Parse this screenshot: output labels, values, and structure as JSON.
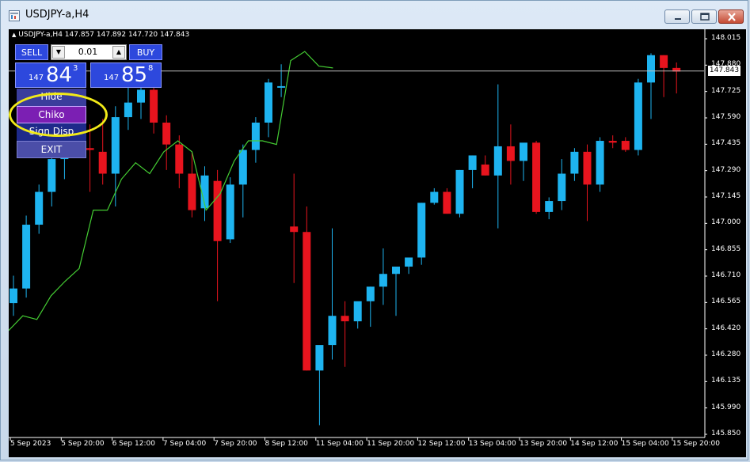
{
  "window": {
    "title": "USDJPY-a,H4"
  },
  "chart_header": {
    "symbol_line": "USDJPY-a,H4  147.857 147.892 147.720 147.843"
  },
  "trade_panel": {
    "sell_label": "SELL",
    "buy_label": "BUY",
    "lot_value": "0.01",
    "sell_price": {
      "prefix": "147",
      "big": "84",
      "sup": "3"
    },
    "buy_price": {
      "prefix": "147",
      "big": "85",
      "sup": "8"
    },
    "menu": [
      {
        "label": "Hide",
        "color": "#3a3d9c"
      },
      {
        "label": "Chiko",
        "color": "#7b1fb3"
      },
      {
        "label": "Sign Disp",
        "color": "#1e2a8a"
      },
      {
        "label": "EXIT",
        "color": "#4b4ea8"
      }
    ]
  },
  "current_price": "147.843",
  "colors": {
    "bull": "#1eb4f0",
    "bear": "#e8141e",
    "line": "#44cc33",
    "highlight": "#f2ea18"
  },
  "chart_data": {
    "type": "candlestick",
    "y_axis_labels": [
      "148.015",
      "147.880",
      "147.725",
      "147.590",
      "147.435",
      "147.290",
      "147.145",
      "147.000",
      "146.855",
      "146.710",
      "146.565",
      "146.420",
      "146.280",
      "146.135",
      "145.990",
      "145.850"
    ],
    "x_axis_labels": [
      "5 Sep 2023",
      "5 Sep 20:00",
      "6 Sep 12:00",
      "7 Sep 04:00",
      "7 Sep 20:00",
      "8 Sep 12:00",
      "11 Sep 04:00",
      "11 Sep 20:00",
      "12 Sep 12:00",
      "13 Sep 04:00",
      "13 Sep 20:00",
      "14 Sep 12:00",
      "15 Sep 04:00",
      "15 Sep 20:00"
    ],
    "ylim": [
      145.85,
      148.02
    ],
    "candles": [
      {
        "o": 146.57,
        "h": 146.72,
        "l": 146.5,
        "c": 146.65
      },
      {
        "o": 146.65,
        "h": 147.05,
        "l": 146.6,
        "c": 147.0
      },
      {
        "o": 147.0,
        "h": 147.22,
        "l": 146.95,
        "c": 147.18
      },
      {
        "o": 147.18,
        "h": 147.44,
        "l": 147.1,
        "c": 147.36
      },
      {
        "o": 147.36,
        "h": 147.52,
        "l": 147.25,
        "c": 147.5
      },
      {
        "o": 147.5,
        "h": 147.62,
        "l": 147.38,
        "c": 147.42
      },
      {
        "o": 147.42,
        "h": 147.55,
        "l": 147.18,
        "c": 147.41
      },
      {
        "o": 147.4,
        "h": 147.58,
        "l": 147.22,
        "c": 147.28
      },
      {
        "o": 147.28,
        "h": 147.65,
        "l": 147.1,
        "c": 147.59
      },
      {
        "o": 147.59,
        "h": 147.76,
        "l": 147.52,
        "c": 147.67
      },
      {
        "o": 147.67,
        "h": 147.8,
        "l": 147.58,
        "c": 147.74
      },
      {
        "o": 147.74,
        "h": 147.8,
        "l": 147.5,
        "c": 147.56
      },
      {
        "o": 147.56,
        "h": 147.6,
        "l": 147.3,
        "c": 147.44
      },
      {
        "o": 147.44,
        "h": 147.49,
        "l": 147.2,
        "c": 147.28
      },
      {
        "o": 147.28,
        "h": 147.4,
        "l": 147.04,
        "c": 147.08
      },
      {
        "o": 147.09,
        "h": 147.32,
        "l": 147.02,
        "c": 147.27
      },
      {
        "o": 147.24,
        "h": 147.3,
        "l": 146.58,
        "c": 146.91
      },
      {
        "o": 146.92,
        "h": 147.26,
        "l": 146.9,
        "c": 147.22
      },
      {
        "o": 147.22,
        "h": 147.44,
        "l": 147.04,
        "c": 147.41
      },
      {
        "o": 147.41,
        "h": 147.59,
        "l": 147.34,
        "c": 147.56
      },
      {
        "o": 147.56,
        "h": 147.8,
        "l": 147.48,
        "c": 147.78
      },
      {
        "o": 147.76,
        "h": 147.88,
        "l": 147.7,
        "c": 147.76
      },
      {
        "o": 146.99,
        "h": 147.28,
        "l": 146.68,
        "c": 146.96
      },
      {
        "o": 146.96,
        "h": 147.1,
        "l": 146.2,
        "c": 146.2
      },
      {
        "o": 146.2,
        "h": 146.29,
        "l": 145.9,
        "c": 146.34
      },
      {
        "o": 146.34,
        "h": 146.98,
        "l": 146.26,
        "c": 146.5
      },
      {
        "o": 146.5,
        "h": 146.58,
        "l": 146.22,
        "c": 146.47
      },
      {
        "o": 146.47,
        "h": 146.54,
        "l": 146.43,
        "c": 146.58
      },
      {
        "o": 146.58,
        "h": 146.66,
        "l": 146.44,
        "c": 146.66
      },
      {
        "o": 146.66,
        "h": 146.87,
        "l": 146.56,
        "c": 146.73
      },
      {
        "o": 146.73,
        "h": 146.76,
        "l": 146.5,
        "c": 146.77
      },
      {
        "o": 146.77,
        "h": 146.8,
        "l": 146.73,
        "c": 146.82
      },
      {
        "o": 146.82,
        "h": 147.12,
        "l": 146.78,
        "c": 147.12
      },
      {
        "o": 147.12,
        "h": 147.2,
        "l": 147.11,
        "c": 147.18
      },
      {
        "o": 147.18,
        "h": 147.2,
        "l": 147.06,
        "c": 147.06
      },
      {
        "o": 147.06,
        "h": 147.3,
        "l": 147.04,
        "c": 147.3
      },
      {
        "o": 147.3,
        "h": 147.38,
        "l": 147.2,
        "c": 147.38
      },
      {
        "o": 147.33,
        "h": 147.38,
        "l": 147.27,
        "c": 147.27
      },
      {
        "o": 147.27,
        "h": 147.77,
        "l": 146.98,
        "c": 147.43
      },
      {
        "o": 147.43,
        "h": 147.55,
        "l": 147.22,
        "c": 147.35
      },
      {
        "o": 147.35,
        "h": 147.44,
        "l": 147.24,
        "c": 147.45
      },
      {
        "o": 147.45,
        "h": 147.46,
        "l": 147.06,
        "c": 147.07
      },
      {
        "o": 147.07,
        "h": 147.15,
        "l": 147.03,
        "c": 147.13
      },
      {
        "o": 147.13,
        "h": 147.36,
        "l": 147.08,
        "c": 147.28
      },
      {
        "o": 147.28,
        "h": 147.42,
        "l": 147.24,
        "c": 147.4
      },
      {
        "o": 147.4,
        "h": 147.44,
        "l": 147.02,
        "c": 147.22
      },
      {
        "o": 147.22,
        "h": 147.48,
        "l": 147.18,
        "c": 147.46
      },
      {
        "o": 147.46,
        "h": 147.49,
        "l": 147.42,
        "c": 147.45
      },
      {
        "o": 147.46,
        "h": 147.48,
        "l": 147.4,
        "c": 147.41
      },
      {
        "o": 147.41,
        "h": 147.8,
        "l": 147.38,
        "c": 147.78
      },
      {
        "o": 147.78,
        "h": 147.94,
        "l": 147.58,
        "c": 147.93
      },
      {
        "o": 147.93,
        "h": 147.93,
        "l": 147.7,
        "c": 147.86
      },
      {
        "o": 147.86,
        "h": 147.89,
        "l": 147.72,
        "c": 147.84
      }
    ],
    "line_series": [
      146.42,
      146.5,
      146.48,
      146.61,
      146.69,
      146.76,
      147.08,
      147.08,
      147.25,
      147.34,
      147.28,
      147.4,
      147.46,
      147.4,
      147.08,
      147.17,
      147.35,
      147.46,
      147.46,
      147.44,
      147.9,
      147.95,
      147.87,
      147.86
    ]
  }
}
